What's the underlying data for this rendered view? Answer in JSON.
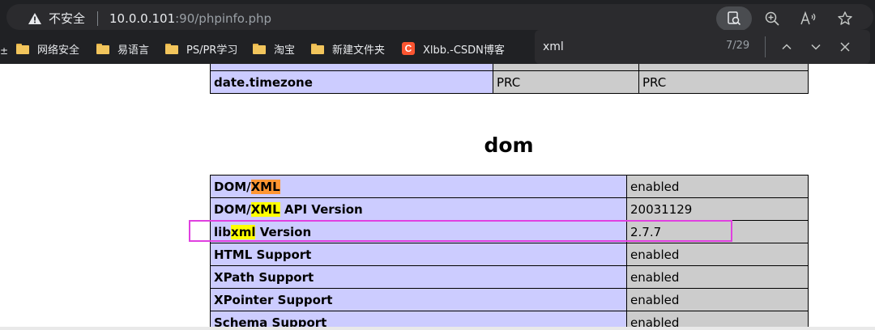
{
  "browser": {
    "security_label": "不安全",
    "url_host": "10.0.0.101",
    "url_rest": ":90/phpinfo.php",
    "bookmarks_overflow": "±",
    "bookmarks": [
      {
        "label": "网络安全",
        "icon": "folder-icon"
      },
      {
        "label": "易语言",
        "icon": "folder-icon"
      },
      {
        "label": "PS/PR学习",
        "icon": "folder-icon"
      },
      {
        "label": "淘宝",
        "icon": "folder-icon"
      },
      {
        "label": "新建文件夹",
        "icon": "folder-icon"
      },
      {
        "label": "Xlbb.-CSDN博客",
        "icon": "csdn-icon",
        "icon_text": "C"
      }
    ]
  },
  "findbar": {
    "query": "xml",
    "count": "7/29"
  },
  "page": {
    "date_table": [
      {
        "directive": "date.timezone",
        "local": "PRC",
        "master": "PRC"
      }
    ],
    "section_title": "dom",
    "dom_rows": [
      {
        "pre": "DOM/",
        "match": "XML",
        "post": "",
        "value": "enabled",
        "active": true
      },
      {
        "pre": "DOM/",
        "match": "XML",
        "post": " API Version",
        "value": "20031129"
      },
      {
        "pre": "lib",
        "match": "xml",
        "post": " Version",
        "value": "2.7.7"
      },
      {
        "pre": "HTML Support",
        "match": "",
        "post": "",
        "value": "enabled"
      },
      {
        "pre": "XPath Support",
        "match": "",
        "post": "",
        "value": "enabled"
      },
      {
        "pre": "XPointer Support",
        "match": "",
        "post": "",
        "value": "enabled"
      },
      {
        "pre": "Schema Support",
        "match": "",
        "post": "",
        "value": "enabled"
      }
    ]
  },
  "colors": {
    "chrome_bg": "#202124",
    "header_cell": "#ccccff",
    "value_cell": "#cccccc",
    "highlight": "#ffff00",
    "active_highlight": "#ff9632",
    "annotation": "#e040e0"
  }
}
